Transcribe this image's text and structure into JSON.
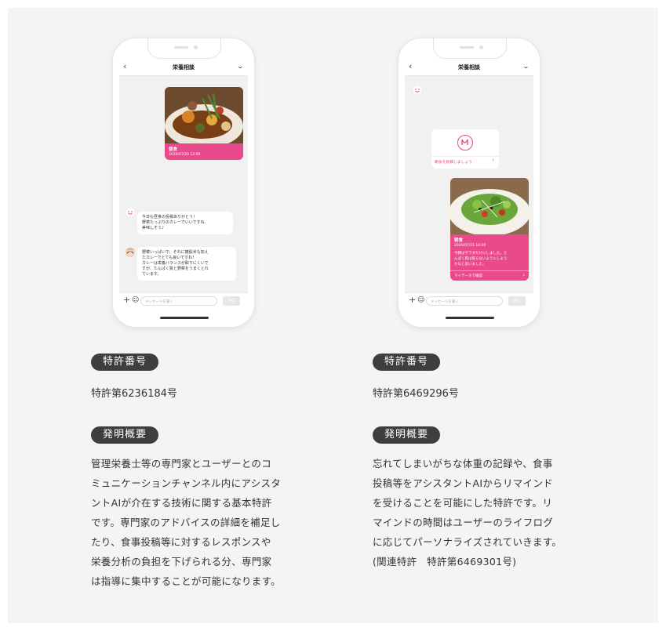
{
  "left": {
    "nav_title": "栄養相談",
    "meal_card": {
      "title": "昼食",
      "date": "2020/07/20 12:00"
    },
    "bot_message": [
      "今日も昼食の投稿ありがとう！",
      "野菜たっぷりのカレーでいいですね、",
      "美味しそう♪"
    ],
    "expert_message": [
      "野菜いっぱいで、それに雑穀米も加え",
      "たカレーでとても良いですね！",
      "カレーは栄養バランスが取りにくいで",
      "すが、たんぱく質と野菜をうまくとれ",
      "ています。"
    ],
    "input_placeholder": "メッセージを書く",
    "send_label": "送信",
    "patent_label": "特許番号",
    "patent_number": "特許第6236184号",
    "summary_label": "発明概要",
    "summary_lines": [
      "管理栄養士等の専門家とユーザーとのコ",
      "ミュニケーションチャンネル内にアシスタ",
      "ントAIが介在する技術に関する基本特許",
      "です。専門家のアドバイスの詳細を補足し",
      "たり、食事投稿等に対するレスポンスや",
      "栄養分析の負担を下げられる分、専門家",
      "は指導に集中することが可能になります。"
    ]
  },
  "right": {
    "nav_title": "栄養相談",
    "reminder_link": "朝食を投稿しましょう",
    "meal_card": {
      "title": "朝食",
      "date": "2020/07/21 10:00",
      "note": [
        "今朝はサラダだけにしました。た",
        "んぱく質は取らないようにしよう",
        "かなと思いました。"
      ],
      "link": "マイデータで確認"
    },
    "input_placeholder": "メッセージを書く",
    "send_label": "送信",
    "patent_label": "特許番号",
    "patent_number": "特許第6469296号",
    "summary_label": "発明概要",
    "summary_lines": [
      "忘れてしまいがちな体重の記録や、食事",
      "投稿等をアシスタントAIからリマインド",
      "を受けることを可能にした特許です。リ",
      "マインドの時間はユーザーのライフログ",
      "に応じてパーソナライズされていきます。",
      "(関連特許　特許第6469301号)"
    ]
  },
  "icons": {
    "back": "chevron-left-icon",
    "dropdown": "chevron-down-icon",
    "add": "plus-icon",
    "emoji": "smiley-icon",
    "bot": "bot-face-icon"
  },
  "colors": {
    "accent": "#e84a8b",
    "pill": "#3e3e3e",
    "panel_bg": "#f4f4f4"
  }
}
